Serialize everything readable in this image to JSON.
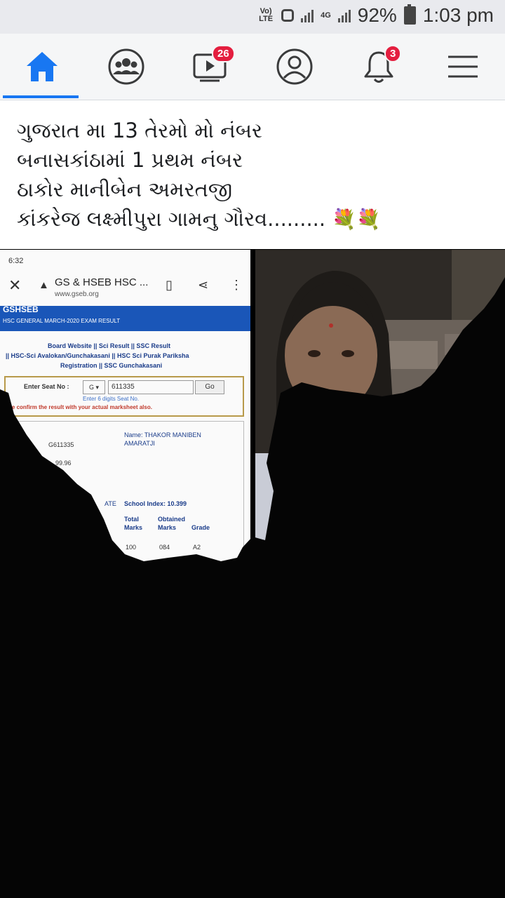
{
  "status_bar": {
    "network_label": "Vo) LTE",
    "lte": "4G",
    "battery": "92%",
    "time": "1:03 pm"
  },
  "nav": {
    "items": [
      {
        "icon": "home-icon",
        "active": true
      },
      {
        "icon": "groups-icon"
      },
      {
        "icon": "watch-icon",
        "badge": "26"
      },
      {
        "icon": "profile-icon"
      },
      {
        "icon": "bell-icon",
        "badge": "3"
      },
      {
        "icon": "menu-icon"
      }
    ]
  },
  "post": {
    "lines": [
      "ગુજરાત મા 13 તેરમો મો નંબર",
      "બનાસકાંઠામાં 1 પ્રથમ નંબર",
      "ઠાકોર માનીબેન અમરતજી",
      "કાંકરેજ લક્ષ્મીપુરા ગામનુ ગૌરવ........."
    ],
    "emoji": "💐💐"
  },
  "screenshot": {
    "time": "6:32",
    "site_title": "GS & HSEB HSC ...",
    "site_url": "www.gseb.org",
    "brand": "GSHSEB",
    "banner": "HSC GENERAL MARCH-2020 EXAM RESULT",
    "links_1": "Board Website || Sci Result || SSC Result",
    "links_2": "|| HSC-Sci Avalokan/Gunchakasani || HSC Sci Purak Pariksha",
    "links_3": "Registration || SSC Gunchakasani",
    "seat_label": "Enter Seat No :",
    "seat_prefix": "G ▾",
    "seat_value": "611335",
    "go": "Go",
    "hint": "Enter 6 digits Seat No.",
    "warning": "ase confirm the result with your actual marksheet also.",
    "seat_result": "G611335",
    "percent": "99.96",
    "name_label": "Name: THAKOR MANIBEN",
    "name_2": "AMARATJI",
    "state": "ATE",
    "school_index": "School Index: 10.399",
    "col_total": "Total",
    "col_marks": "Marks",
    "col_obtained": "Obtained",
    "col_obtained_marks": "Marks",
    "col_grade": "Grade",
    "row_total": "100",
    "row_obtained": "084",
    "row_grade": "A2"
  },
  "colors": {
    "accent": "#1877f2",
    "badge": "#e41e3f",
    "banner": "#1a56b8"
  }
}
